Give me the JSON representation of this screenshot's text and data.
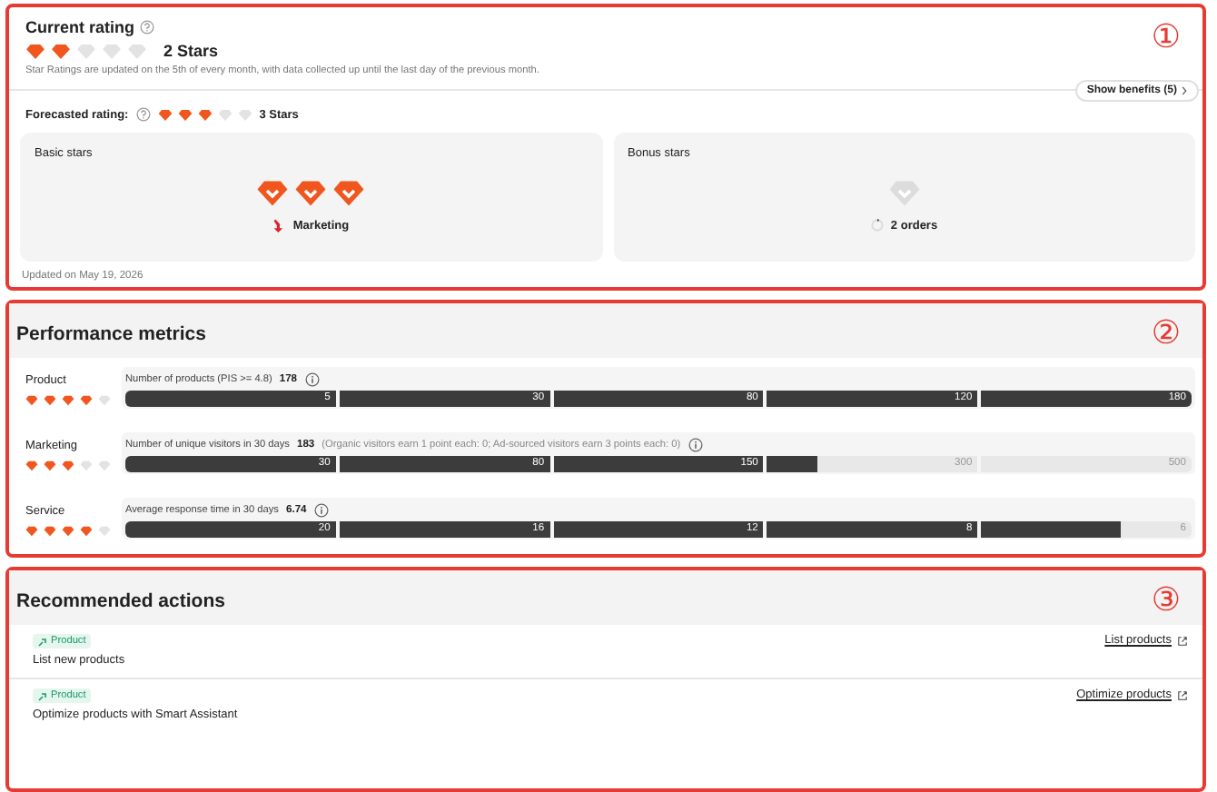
{
  "rating": {
    "marker": "①",
    "title": "Current rating",
    "stars": 2,
    "stars_label": "2 Stars",
    "note": "Star Ratings are updated on the 5th of every month, with data collected up until the last day of the previous month.",
    "benefits_button": "Show benefits (5)",
    "forecast": {
      "label": "Forecasted rating:",
      "stars": 3,
      "stars_label": "3 Stars"
    },
    "cards": [
      {
        "title": "Basic stars",
        "gems": [
          {
            "earned": true
          },
          {
            "earned": true
          },
          {
            "earned": true
          }
        ],
        "kind": "basic",
        "caption": "Marketing"
      },
      {
        "title": "Bonus stars",
        "gems": [
          {
            "earned": false
          }
        ],
        "kind": "bonus",
        "caption": "2 orders"
      }
    ],
    "updated": "Updated on May 19, 2026"
  },
  "performance": {
    "marker": "②",
    "title": "Performance metrics",
    "rows": [
      {
        "name": "Product",
        "stars": 4,
        "metric": "Number of products (PIS >= 4.8)",
        "value": "178",
        "segments": [
          {
            "label": "5",
            "level": 1
          },
          {
            "label": "30",
            "level": 1
          },
          {
            "label": "80",
            "level": 1
          },
          {
            "label": "120",
            "level": 1
          },
          {
            "label": "180",
            "level": 1
          }
        ]
      },
      {
        "name": "Marketing",
        "stars": 3,
        "metric": "Number of unique visitors in 30 days",
        "value": "183",
        "detail": "(Organic visitors earn 1 point each: 0; Ad-sourced visitors earn 3 points each: 0)",
        "segments": [
          {
            "label": "30",
            "level": 1
          },
          {
            "label": "80",
            "level": 1
          },
          {
            "label": "150",
            "level": 1
          },
          {
            "label": "300",
            "level": 0.24
          },
          {
            "label": "500"
          }
        ]
      },
      {
        "name": "Service",
        "stars": 4,
        "metric": "Average response time in 30 days",
        "value": "6.74",
        "segments": [
          {
            "label": "20",
            "level": 1
          },
          {
            "label": "16",
            "level": 1
          },
          {
            "label": "12",
            "level": 1
          },
          {
            "label": "8",
            "level": 1
          },
          {
            "label": "6",
            "level": 0.66
          }
        ]
      }
    ]
  },
  "actions": {
    "marker": "③",
    "title": "Recommended actions",
    "items": [
      {
        "tag": "Product",
        "text": "List new products",
        "link": "List products"
      },
      {
        "tag": "Product",
        "text": "Optimize products with Smart Assistant",
        "link": "Optimize products"
      }
    ]
  }
}
